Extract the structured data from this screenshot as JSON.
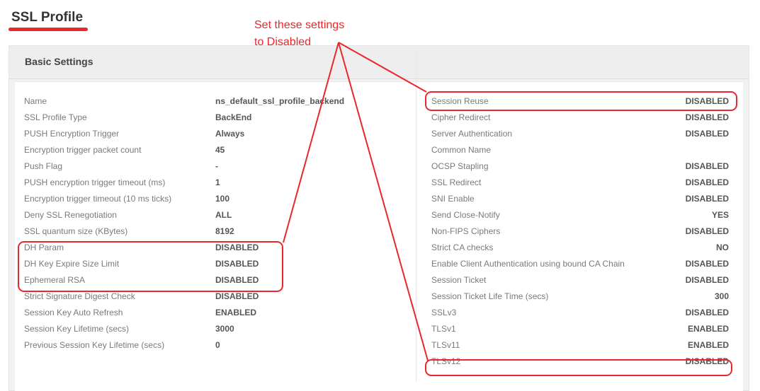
{
  "page_title": "SSL Profile",
  "annotation": {
    "line1": "Set these settings",
    "line2": "to Disabled"
  },
  "panel_header": "Basic Settings",
  "left_settings": [
    {
      "label": "Name",
      "value": "ns_default_ssl_profile_backend"
    },
    {
      "label": "SSL Profile Type",
      "value": "BackEnd"
    },
    {
      "label": "PUSH Encryption Trigger",
      "value": "Always"
    },
    {
      "label": "Encryption trigger packet count",
      "value": "45"
    },
    {
      "label": "Push Flag",
      "value": "-"
    },
    {
      "label": "PUSH encryption trigger timeout (ms)",
      "value": "1"
    },
    {
      "label": "Encryption trigger timeout (10 ms ticks)",
      "value": "100"
    },
    {
      "label": "Deny SSL Renegotiation",
      "value": "ALL"
    },
    {
      "label": "SSL quantum size (KBytes)",
      "value": "8192"
    },
    {
      "label": "DH Param",
      "value": "DISABLED"
    },
    {
      "label": "DH Key Expire Size Limit",
      "value": "DISABLED"
    },
    {
      "label": "Ephemeral RSA",
      "value": "DISABLED"
    },
    {
      "label": "Strict Signature Digest Check",
      "value": "DISABLED"
    },
    {
      "label": "Session Key Auto Refresh",
      "value": "ENABLED"
    },
    {
      "label": "Session Key Lifetime (secs)",
      "value": "3000"
    },
    {
      "label": "Previous Session Key Lifetime (secs)",
      "value": "0"
    }
  ],
  "right_settings": [
    {
      "label": "Session Reuse",
      "value": "DISABLED"
    },
    {
      "label": "Cipher Redirect",
      "value": "DISABLED"
    },
    {
      "label": "Server Authentication",
      "value": "DISABLED"
    },
    {
      "label": "Common Name",
      "value": ""
    },
    {
      "label": "OCSP Stapling",
      "value": "DISABLED"
    },
    {
      "label": "SSL Redirect",
      "value": "DISABLED"
    },
    {
      "label": "SNI Enable",
      "value": "DISABLED"
    },
    {
      "label": "Send Close-Notify",
      "value": "YES"
    },
    {
      "label": "Non-FIPS Ciphers",
      "value": "DISABLED"
    },
    {
      "label": "Strict CA checks",
      "value": "NO"
    },
    {
      "label": "Enable Client Authentication using bound CA Chain",
      "value": "DISABLED"
    },
    {
      "label": "Session Ticket",
      "value": "DISABLED"
    },
    {
      "label": "Session Ticket Life Time (secs)",
      "value": "300"
    },
    {
      "label": "SSLv3",
      "value": "DISABLED"
    },
    {
      "label": "TLSv1",
      "value": "ENABLED"
    },
    {
      "label": "TLSv11",
      "value": "ENABLED"
    },
    {
      "label": "TLSv12",
      "value": "DISABLED"
    }
  ],
  "colors": {
    "annotation": "#e8282b",
    "label_text": "#7a7a7a",
    "value_text": "#555555",
    "panel_bg": "#f1f1f1"
  }
}
